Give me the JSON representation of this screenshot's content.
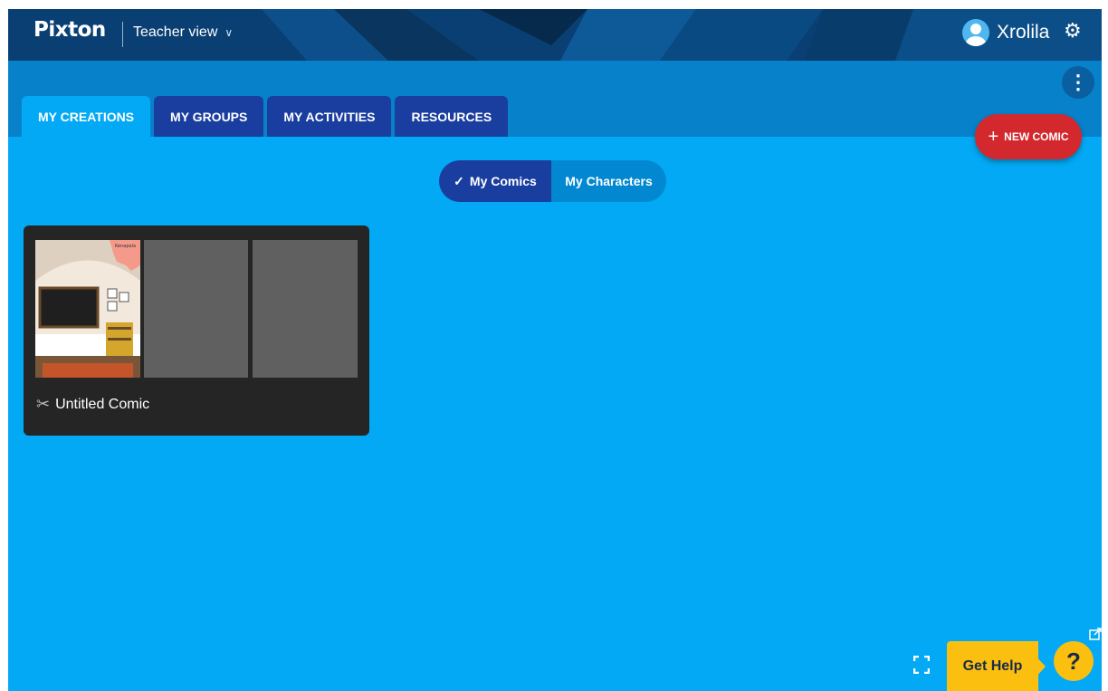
{
  "header": {
    "logo": "Pixton",
    "view_label": "Teacher view",
    "username": "Xrolila",
    "icons": {
      "avatar": "user-avatar-icon",
      "settings": "gear-icon",
      "dropdown": "chevron-down-icon"
    }
  },
  "tabs": [
    {
      "label": "MY CREATIONS",
      "active": true
    },
    {
      "label": "MY GROUPS",
      "active": false
    },
    {
      "label": "MY ACTIVITIES",
      "active": false
    },
    {
      "label": "RESOURCES",
      "active": false
    }
  ],
  "new_comic_label": "NEW COMIC",
  "toggle": {
    "selected": "My Comics",
    "other": "My Characters"
  },
  "comics": [
    {
      "title": "Untitled Comic",
      "panels": 3,
      "bubble_text": "Kenapala"
    }
  ],
  "help": {
    "label": "Get Help",
    "symbol": "?"
  },
  "colors": {
    "background": "#03A9F4",
    "header": "#0a3f73",
    "tab": "#1a3ea0",
    "new_comic": "#d3282e",
    "help": "#fbbf0f"
  }
}
